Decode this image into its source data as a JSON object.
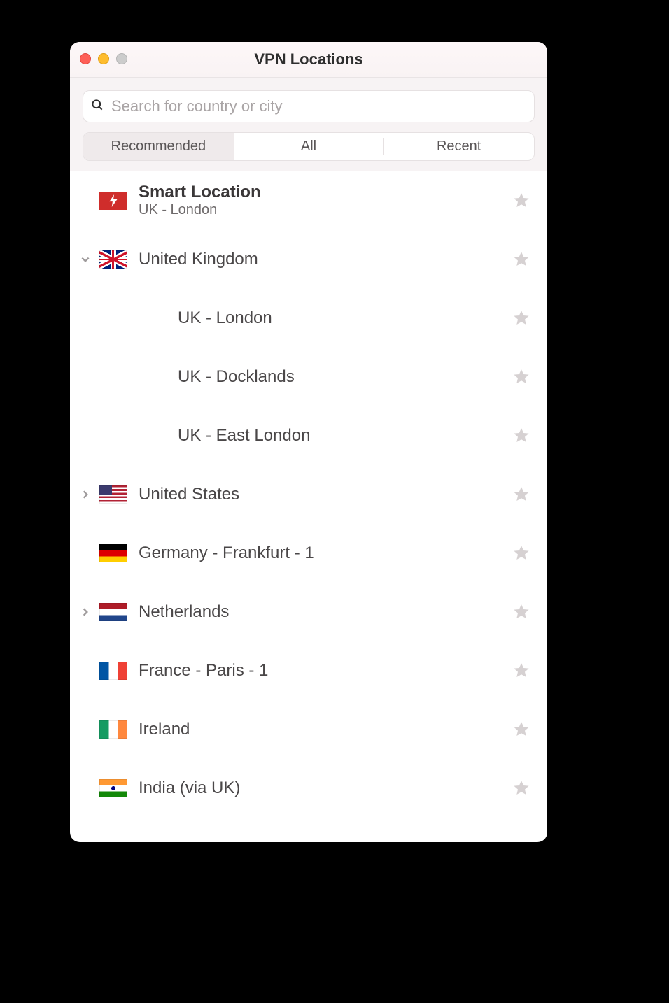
{
  "window": {
    "title": "VPN Locations"
  },
  "search": {
    "placeholder": "Search for country or city",
    "value": ""
  },
  "tabs": {
    "recommended": "Recommended",
    "all": "All",
    "recent": "Recent",
    "active": "recommended"
  },
  "smart": {
    "title": "Smart Location",
    "subtitle": "UK - London"
  },
  "locations": [
    {
      "name": "United Kingdom",
      "flag": "uk",
      "expandable": true,
      "expanded": true,
      "children": [
        {
          "name": "UK - London"
        },
        {
          "name": "UK - Docklands"
        },
        {
          "name": "UK - East London"
        }
      ]
    },
    {
      "name": "United States",
      "flag": "us",
      "expandable": true,
      "expanded": false
    },
    {
      "name": "Germany - Frankfurt - 1",
      "flag": "de",
      "expandable": false
    },
    {
      "name": "Netherlands",
      "flag": "nl",
      "expandable": true,
      "expanded": false
    },
    {
      "name": "France - Paris - 1",
      "flag": "fr",
      "expandable": false
    },
    {
      "name": "Ireland",
      "flag": "ie",
      "expandable": false
    },
    {
      "name": "India (via UK)",
      "flag": "in",
      "expandable": false
    }
  ]
}
